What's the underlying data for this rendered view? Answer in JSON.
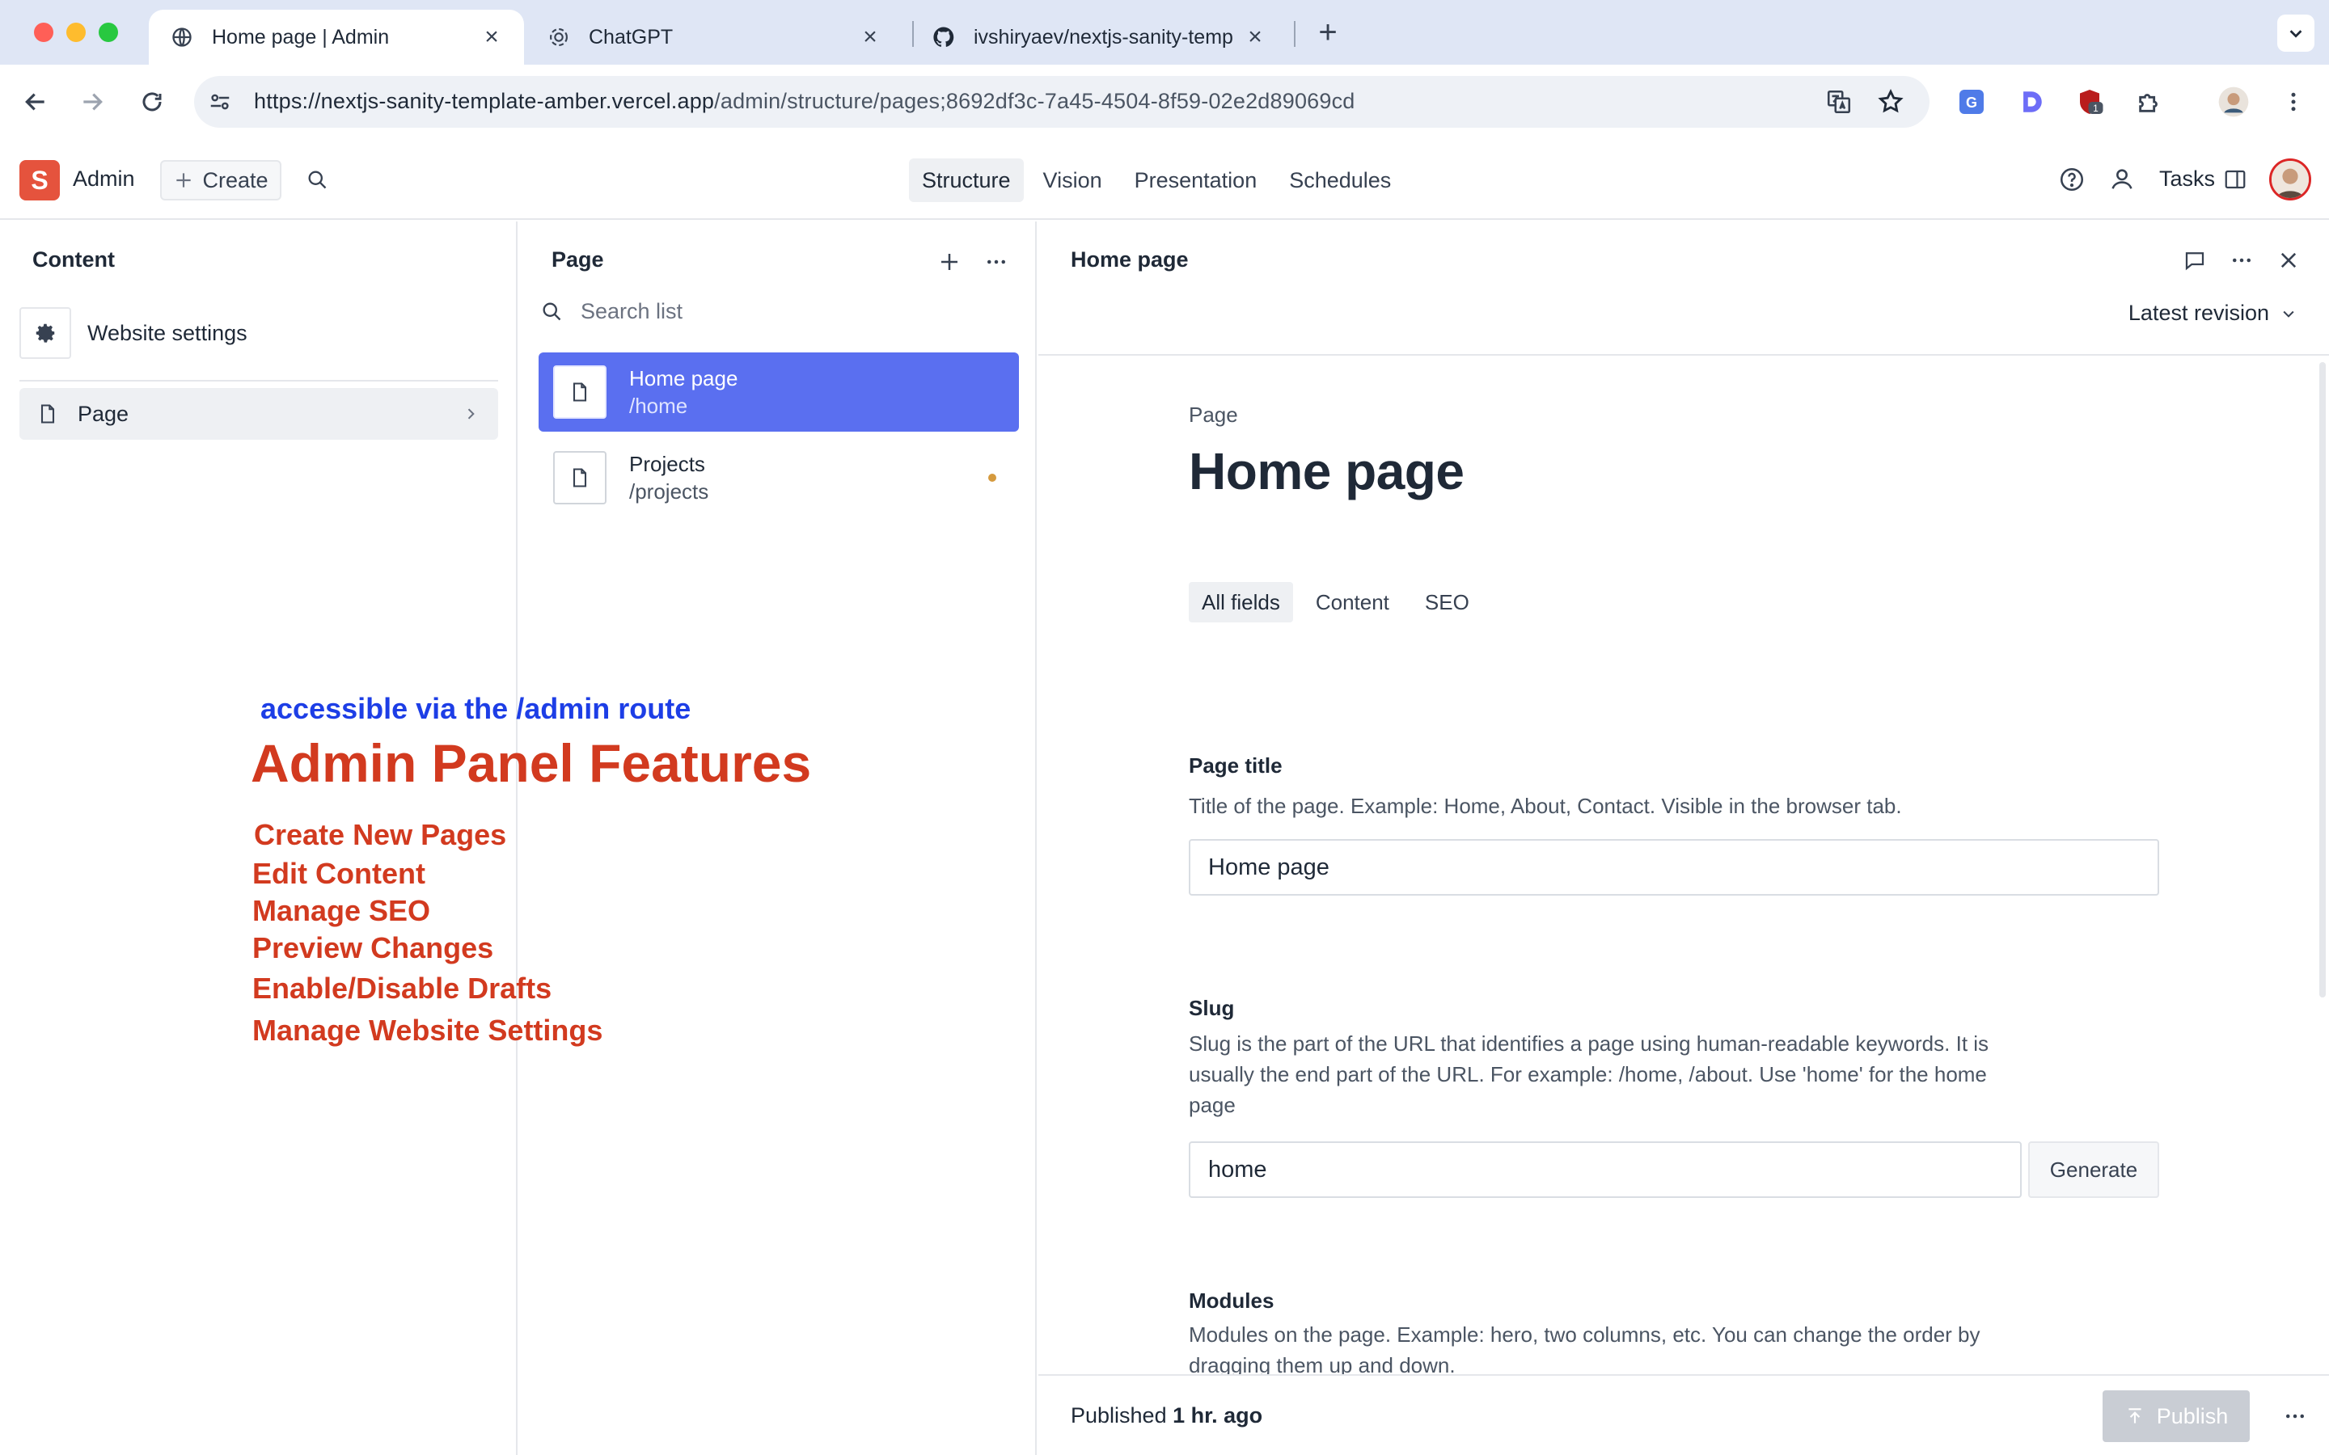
{
  "browser": {
    "tabs": [
      {
        "title": "Home page | Admin",
        "icon": "globe-icon",
        "active": true
      },
      {
        "title": "ChatGPT",
        "icon": "chatgpt-icon",
        "active": false
      },
      {
        "title": "ivshiryaev/nextjs-sanity-temp",
        "icon": "github-icon",
        "active": false
      }
    ],
    "url_main": "https://nextjs-sanity-template-amber.vercel.app",
    "url_path": "/admin/structure/pages;8692df3c-7a45-4504-8f59-02e2d89069cd",
    "extension_badge": "1"
  },
  "studio": {
    "logo_letter": "S",
    "workspace": "Admin",
    "create_label": "Create",
    "tools": [
      "Structure",
      "Vision",
      "Presentation",
      "Schedules"
    ],
    "active_tool": "Structure",
    "tasks_label": "Tasks"
  },
  "content_pane": {
    "title": "Content",
    "settings_label": "Website settings",
    "page_label": "Page"
  },
  "list_pane": {
    "title": "Page",
    "search_placeholder": "Search list",
    "documents": [
      {
        "title": "Home page",
        "slug": "/home",
        "selected": true
      },
      {
        "title": "Projects",
        "slug": "/projects",
        "selected": false
      }
    ]
  },
  "document": {
    "header_title": "Home page",
    "revision": "Latest revision",
    "type_label": "Page",
    "title": "Home page",
    "field_tabs": [
      "All fields",
      "Content",
      "SEO"
    ],
    "page_title_field": {
      "label": "Page title",
      "description": "Title of the page. Example: Home, About, Contact. Visible in the browser tab.",
      "value": "Home page"
    },
    "slug_field": {
      "label": "Slug",
      "description": "Slug is the part of the URL that identifies a page using human-readable keywords. It is usually the end part of the URL. For example: /home, /about. Use 'home' for the home page",
      "value": "home",
      "generate_label": "Generate"
    },
    "modules_field": {
      "label": "Modules",
      "description": "Modules on the page. Example: hero, two columns, etc. You can change the order by dragging them up and down."
    },
    "footer": {
      "status_prefix": "Published",
      "status_time": "1 hr. ago",
      "publish_label": "Publish"
    }
  },
  "overlay": {
    "subtitle": "accessible via the /admin route",
    "title": "Admin Panel Features",
    "features": [
      "Create New Pages",
      "Edit Content",
      "Manage SEO",
      "Preview Changes",
      "Enable/Disable Drafts",
      "Manage Website Settings"
    ]
  },
  "colors": {
    "accent": "#5a6ff0",
    "logo": "#e5533d",
    "overlay_red": "#d23a1f",
    "overlay_blue": "#1d3ee6"
  }
}
